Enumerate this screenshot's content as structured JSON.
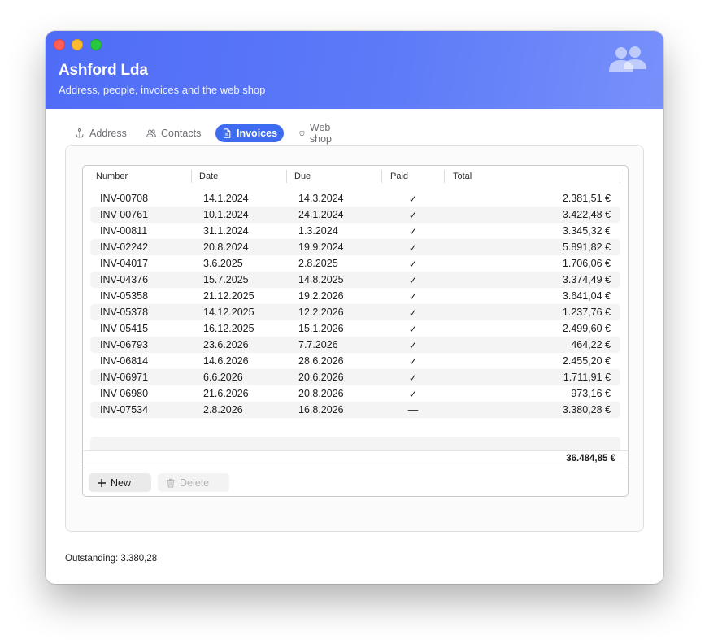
{
  "window": {
    "title": "Ashford Lda",
    "subtitle": "Address, people, invoices and the web shop",
    "header_icon": "people-icon"
  },
  "tabs": [
    {
      "label": "Address",
      "icon": "anchor-icon",
      "active": false
    },
    {
      "label": "Contacts",
      "icon": "people-icon",
      "active": false
    },
    {
      "label": "Invoices",
      "icon": "document-icon",
      "active": true
    },
    {
      "label": "Web shop",
      "icon": "shield-icon",
      "active": false
    }
  ],
  "table": {
    "columns": [
      "Number",
      "Date",
      "Due",
      "Paid",
      "Total"
    ],
    "rows": [
      {
        "number": "INV-00708",
        "date": "14.1.2024",
        "due": "14.3.2024",
        "paid": "✓",
        "total": "2.381,51 €"
      },
      {
        "number": "INV-00761",
        "date": "10.1.2024",
        "due": "24.1.2024",
        "paid": "✓",
        "total": "3.422,48 €"
      },
      {
        "number": "INV-00811",
        "date": "31.1.2024",
        "due": "1.3.2024",
        "paid": "✓",
        "total": "3.345,32 €"
      },
      {
        "number": "INV-02242",
        "date": "20.8.2024",
        "due": "19.9.2024",
        "paid": "✓",
        "total": "5.891,82 €"
      },
      {
        "number": "INV-04017",
        "date": "3.6.2025",
        "due": "2.8.2025",
        "paid": "✓",
        "total": "1.706,06 €"
      },
      {
        "number": "INV-04376",
        "date": "15.7.2025",
        "due": "14.8.2025",
        "paid": "✓",
        "total": "3.374,49 €"
      },
      {
        "number": "INV-05358",
        "date": "21.12.2025",
        "due": "19.2.2026",
        "paid": "✓",
        "total": "3.641,04 €"
      },
      {
        "number": "INV-05378",
        "date": "14.12.2025",
        "due": "12.2.2026",
        "paid": "✓",
        "total": "1.237,76 €"
      },
      {
        "number": "INV-05415",
        "date": "16.12.2025",
        "due": "15.1.2026",
        "paid": "✓",
        "total": "2.499,60 €"
      },
      {
        "number": "INV-06793",
        "date": "23.6.2026",
        "due": "7.7.2026",
        "paid": "✓",
        "total": "464,22 €"
      },
      {
        "number": "INV-06814",
        "date": "14.6.2026",
        "due": "28.6.2026",
        "paid": "✓",
        "total": "2.455,20 €"
      },
      {
        "number": "INV-06971",
        "date": "6.6.2026",
        "due": "20.6.2026",
        "paid": "✓",
        "total": "1.711,91 €"
      },
      {
        "number": "INV-06980",
        "date": "21.6.2026",
        "due": "20.8.2026",
        "paid": "✓",
        "total": "973,16 €"
      },
      {
        "number": "INV-07534",
        "date": "2.8.2026",
        "due": "16.8.2026",
        "paid": "—",
        "total": "3.380,28 €"
      }
    ],
    "grand_total": "36.484,85 €"
  },
  "buttons": {
    "new_label": "New",
    "delete_label": "Delete"
  },
  "status": {
    "text": "Outstanding: 3.380,28"
  },
  "colors": {
    "header_start": "#4f6cf7",
    "header_end": "#7790fa",
    "accent": "#3d6cf0"
  }
}
